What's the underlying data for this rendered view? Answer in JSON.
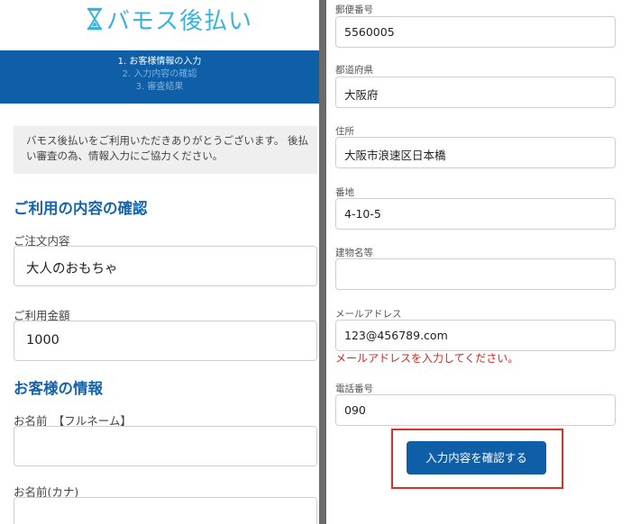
{
  "brand": {
    "logo_text": "バモス後払い"
  },
  "steps": [
    {
      "label": "1. お客様情報の入力"
    },
    {
      "label": "2. 入力内容の確認"
    },
    {
      "label": "3. 審査結果"
    }
  ],
  "notice": "バモス後払いをご利用いただきありがとうございます。 後払い審査の為、情報入力にご協力ください。",
  "order_section": {
    "heading": "ご利用の内容の確認",
    "order_label": "ご注文内容",
    "order_value": "大人のおもちゃ",
    "amount_label": "ご利用金額",
    "amount_value": "1000"
  },
  "customer_section": {
    "heading": "お客様の情報",
    "name_label": "お名前　【フルネーム】",
    "name_value": "",
    "kana_label": "お名前(カナ)",
    "kana_value": ""
  },
  "address_form": {
    "postal_label": "郵便番号",
    "postal_value": "5560005",
    "pref_label": "都道府県",
    "pref_value": "大阪府",
    "address_label": "住所",
    "address_value": "大阪市浪速区日本橋",
    "block_label": "番地",
    "block_value": "4-10-5",
    "building_label": "建物名等",
    "building_value": "",
    "email_label": "メールアドレス",
    "email_value": "123@456789.com",
    "email_error": "メールアドレスを入力してください。",
    "phone_label": "電話番号",
    "phone_value": "090"
  },
  "submit_label": "入力内容を確認する",
  "colors": {
    "brand_blue": "#0f5ea8",
    "logo_cyan": "#3bb3d8",
    "error_red": "#d0281e",
    "highlight_red": "#d9302a"
  }
}
